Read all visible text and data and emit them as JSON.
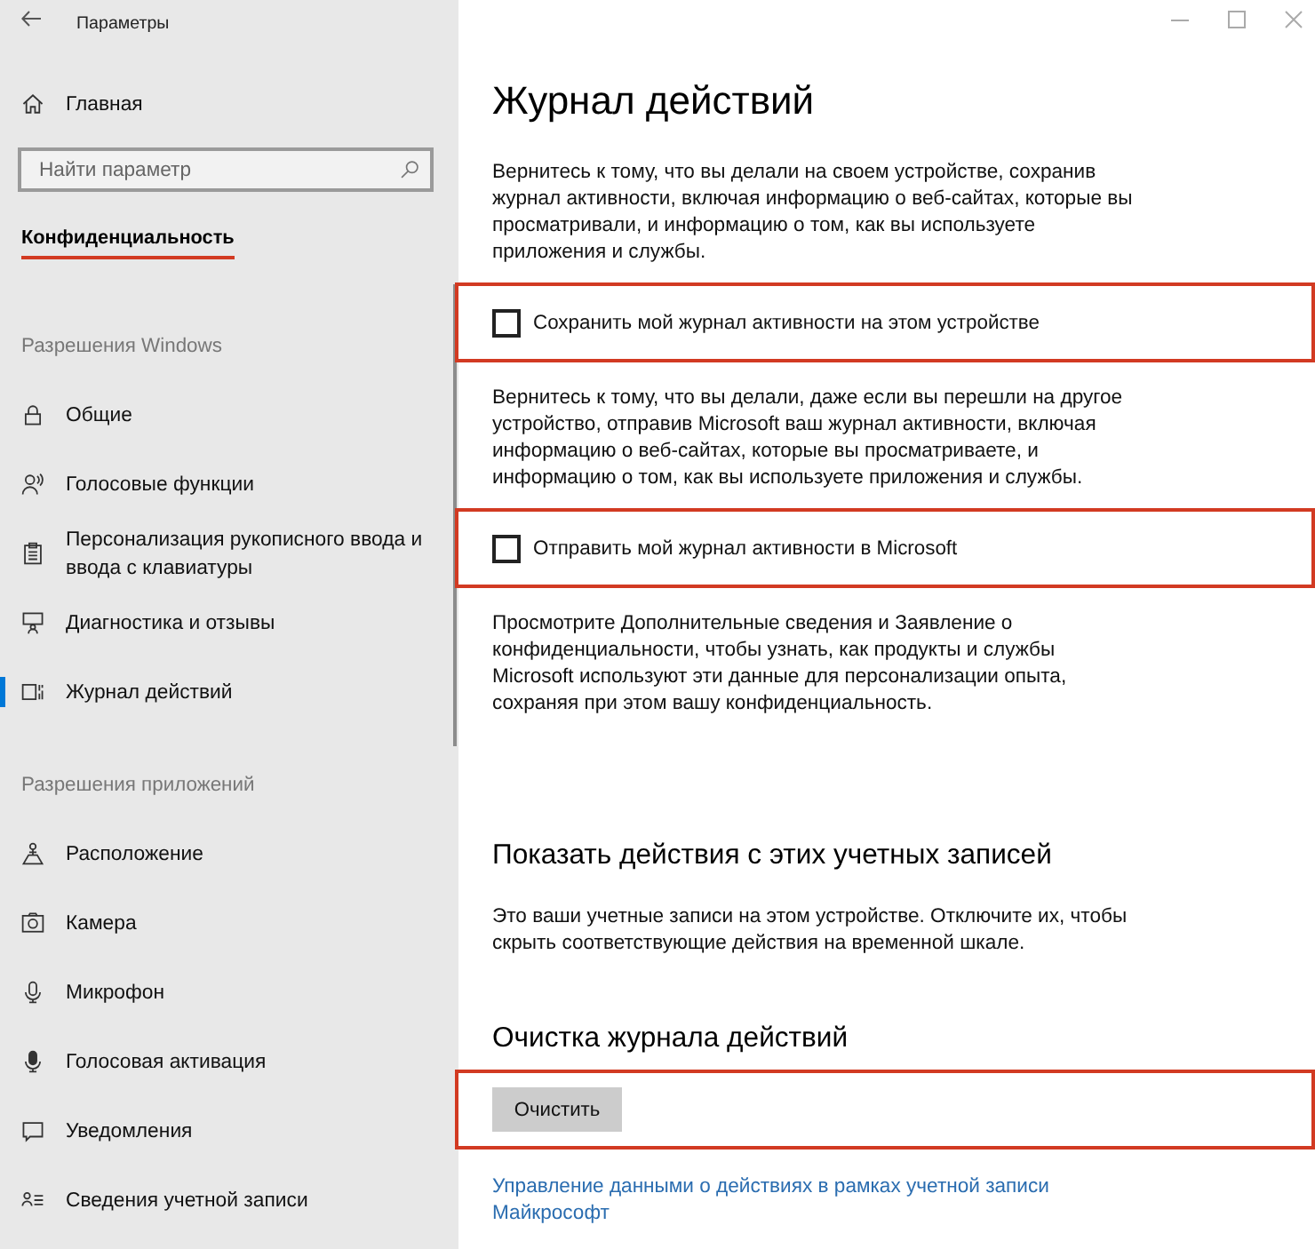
{
  "window": {
    "title": "Параметры"
  },
  "sidebar": {
    "home": {
      "label": "Главная"
    },
    "search": {
      "placeholder": "Найти параметр"
    },
    "category": {
      "text": "Конфиденциальность",
      "highlighted": true
    },
    "groups": [
      {
        "title": "Разрешения Windows",
        "items": [
          {
            "label": "Общие",
            "selected": false
          },
          {
            "label": "Голосовые функции",
            "selected": false
          },
          {
            "label": "Персонализация рукописного ввода и ввода с клавиатуры",
            "selected": false
          },
          {
            "label": "Диагностика и отзывы",
            "selected": false
          },
          {
            "label": "Журнал действий",
            "selected": true
          }
        ]
      },
      {
        "title": "Разрешения приложений",
        "items": [
          {
            "label": "Расположение",
            "selected": false
          },
          {
            "label": "Камера",
            "selected": false
          },
          {
            "label": "Микрофон",
            "selected": false
          },
          {
            "label": "Голосовая активация",
            "selected": false
          },
          {
            "label": "Уведомления",
            "selected": false
          },
          {
            "label": "Сведения учетной записи",
            "selected": false
          }
        ]
      }
    ]
  },
  "content": {
    "title": "Журнал действий",
    "blocks": [
      {
        "kind": "text",
        "text": "Вернитесь к тому, что вы делали на своем устройстве, сохранив журнал активности, включая информацию о веб-сайтах, которые вы просматривали, и информацию о том, как вы используете приложения и службы."
      },
      {
        "kind": "checkbox",
        "label": "Сохранить мой журнал активности на этом устройстве",
        "checked": false,
        "highlighted": true
      },
      {
        "kind": "text",
        "text": "Вернитесь к тому, что вы делали, даже если вы перешли на другое устройство, отправив Microsoft ваш журнал активности, включая информацию о веб-сайтах, которые вы просматриваете, и информацию о том, как вы используете приложения и службы."
      },
      {
        "kind": "checkbox",
        "label": "Отправить мой журнал активности в Microsoft",
        "checked": false,
        "highlighted": true
      },
      {
        "kind": "text",
        "text": "Просмотрите Дополнительные сведения и Заявление о конфиденциальности, чтобы узнать, как продукты и службы Microsoft используют эти данные для персонализации опыта, сохраняя при этом вашу конфиденциальность."
      }
    ],
    "sections": [
      {
        "heading": "Показать действия с этих учетных записей",
        "blocks": [
          {
            "kind": "text",
            "text": "Это ваши учетные записи на этом устройстве. Отключите их, чтобы скрыть соответствующие действия на временной шкале."
          }
        ]
      },
      {
        "heading": "Очистка журнала действий",
        "blocks": [
          {
            "kind": "button",
            "label": "Очистить",
            "highlighted": true
          },
          {
            "kind": "link",
            "text": "Управление данными о действиях в рамках учетной записи Майкрософт"
          }
        ]
      }
    ]
  }
}
